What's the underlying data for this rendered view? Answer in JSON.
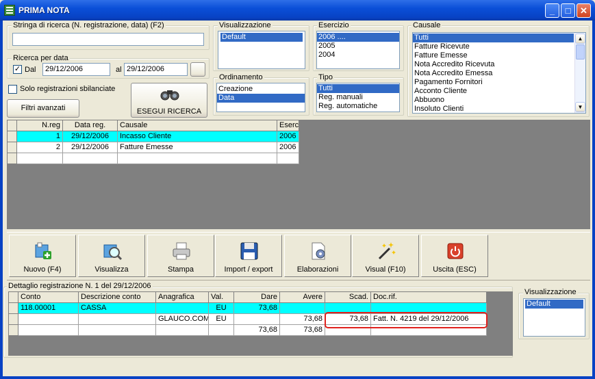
{
  "window": {
    "title": "PRIMA NOTA"
  },
  "search": {
    "label": "Stringa di ricerca (N. registrazione, data) (F2)",
    "value": ""
  },
  "date_search": {
    "label": "Ricerca per data",
    "dal_label": "Dal",
    "dal_checked": "✓",
    "from": "29/12/2006",
    "al_label": "al",
    "to": "29/12/2006"
  },
  "unbalanced": {
    "label": "Solo registrazioni sbilanciate"
  },
  "buttons": {
    "advanced": "Filtri avanzati",
    "run_search": "ESEGUI RICERCA"
  },
  "visualizzazione": {
    "label": "Visualizzazione",
    "items": [
      "Default"
    ]
  },
  "ordinamento": {
    "label": "Ordinamento",
    "items": [
      "Creazione",
      "Data"
    ]
  },
  "esercizio": {
    "label": "Esercizio",
    "items": [
      "2006 ....",
      "2005",
      "2004"
    ]
  },
  "tipo": {
    "label": "Tipo",
    "items": [
      "Tutti",
      "Reg. manuali",
      "Reg. automatiche"
    ]
  },
  "causale": {
    "label": "Causale",
    "items": [
      "Tutti",
      "Fatture Ricevute",
      "Fatture Emesse",
      "Nota Accredito Ricevuta",
      "Nota Accredito Emessa",
      "Pagamento Fornitori",
      "Acconto Cliente",
      "Abbuono",
      "Insoluto Clienti"
    ]
  },
  "reg_table": {
    "headers": [
      "N.reg",
      "Data reg.",
      "Causale",
      "Eserc"
    ],
    "rows": [
      [
        "1",
        "29/12/2006",
        "Incasso Cliente",
        "2006"
      ],
      [
        "2",
        "29/12/2006",
        "Fatture Emesse",
        "2006"
      ]
    ]
  },
  "toolbar": {
    "items": [
      "Nuovo (F4)",
      "Visualizza",
      "Stampa",
      "Import / export",
      "Elaborazioni",
      "Visual (F10)",
      "Uscita (ESC)"
    ]
  },
  "detail": {
    "label": "Dettaglio registrazione N. 1 del 29/12/2006",
    "headers": [
      "Conto",
      "Descrizione conto",
      "Anagrafica",
      "Val.",
      "Dare",
      "Avere",
      "Scad.",
      "Doc.rif."
    ],
    "rows": [
      [
        "118.00001",
        "CASSA",
        "",
        "EU",
        "73,68",
        "",
        "",
        ""
      ],
      [
        "",
        "",
        "GLAUCO.COM",
        "EU",
        "",
        "73,68",
        "73,68",
        "Fatt. N. 4219 del 29/12/2006"
      ],
      [
        "",
        "",
        "",
        "",
        "73,68",
        "73,68",
        "",
        ""
      ]
    ]
  },
  "detail_view": {
    "label": "Visualizzazione",
    "items": [
      "Default"
    ]
  },
  "colors": {
    "highlight": "#316ac5",
    "active_row": "#00ffff",
    "annotation": "#e0201c"
  }
}
